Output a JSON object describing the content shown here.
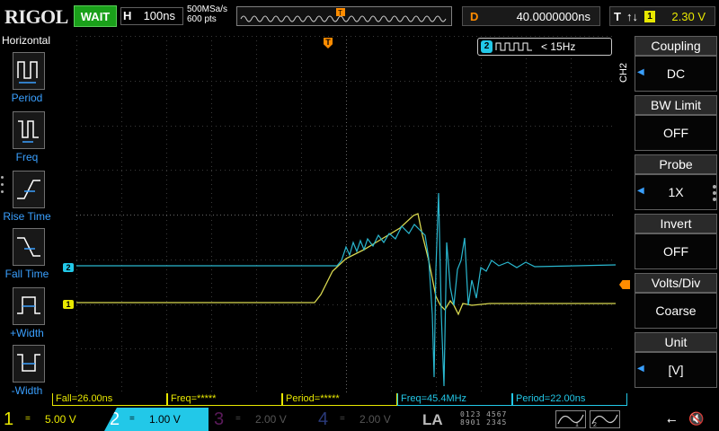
{
  "top": {
    "logo": "RIGOL",
    "status": "WAIT",
    "timebase_label": "H",
    "timebase_value": "100ns",
    "sample_rate": "500MSa/s",
    "memory_depth": "600 pts",
    "delay_label": "D",
    "delay_value": "40.0000000ns",
    "trigger_label": "T",
    "trigger_edge": "↑↓",
    "trigger_channel": "1",
    "trigger_level": "2.30 V"
  },
  "left_panel": {
    "title": "Horizontal",
    "items": [
      {
        "label": "Period",
        "icon": "period-icon"
      },
      {
        "label": "Freq",
        "icon": "freq-icon"
      },
      {
        "label": "Rise Time",
        "icon": "rise-time-icon"
      },
      {
        "label": "Fall Time",
        "icon": "fall-time-icon"
      },
      {
        "label": "+Width",
        "icon": "pos-width-icon"
      },
      {
        "label": "-Width",
        "icon": "neg-width-icon"
      }
    ]
  },
  "screen": {
    "ch2_badge_num": "2",
    "ch2_badge_wave": "⎍⎍⎍⎍",
    "ch2_badge_value": "< 15Hz",
    "ch1_marker": "1",
    "ch2_marker": "2",
    "trigger_marker": "T"
  },
  "right_menu": {
    "channel": "CH2",
    "items": [
      {
        "label": "Coupling",
        "value": "DC"
      },
      {
        "label": "BW Limit",
        "value": "OFF"
      },
      {
        "label": "Probe",
        "value": "1X"
      },
      {
        "label": "Invert",
        "value": "OFF"
      },
      {
        "label": "Volts/Div",
        "value": "Coarse"
      },
      {
        "label": "Unit",
        "value": "[V]"
      }
    ]
  },
  "measurements": [
    {
      "text": "Fall=26.00ns",
      "color": "#e8e800"
    },
    {
      "text": "Freq=*****",
      "color": "#e8e800"
    },
    {
      "text": "Period=*****",
      "color": "#e8e800"
    },
    {
      "text": "Freq=45.4MHz",
      "color": "#22c8e8"
    },
    {
      "text": "Period=22.00ns",
      "color": "#22c8e8"
    }
  ],
  "channels": [
    {
      "num": "1",
      "coupling": "=",
      "scale": "5.00 V",
      "color": "#e8e800"
    },
    {
      "num": "2",
      "coupling": "=",
      "scale": "1.00 V",
      "color": "#22c8e8"
    },
    {
      "num": "3",
      "coupling": "=",
      "scale": "2.00 V",
      "color": "#d000d0"
    },
    {
      "num": "4",
      "coupling": "=",
      "scale": "2.00 V",
      "color": "#3a6aff"
    }
  ],
  "bottom": {
    "la": "LA",
    "digital_bits_1": "0123 4567",
    "digital_bits_2": "8901 2345"
  }
}
